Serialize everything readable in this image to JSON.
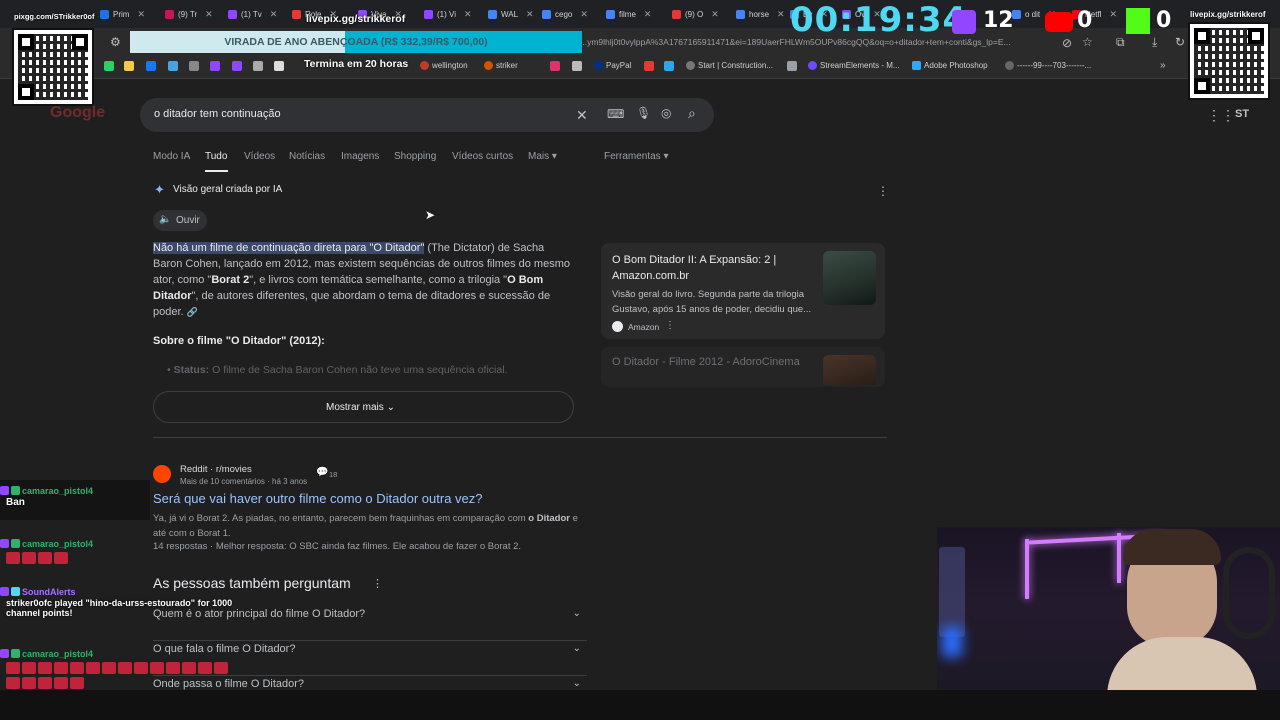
{
  "browser": {
    "tabs": [
      "Prim",
      "(9) Tr",
      "(1) Tv",
      "Role",
      "Viva",
      "(1) Vi",
      "WAL",
      "cego",
      "filme",
      "(9) O",
      "horse",
      "Ev",
      "Ov",
      "o dit",
      "Netfl"
    ],
    "url": "...ym9lhlj0t0vylppA%3A1767165911471&ei=189UaerFHLWm5OUPv86cgQQ&oq=o+ditador+tem+conti&gs_lp=E...",
    "bookmarks": [
      "wellington",
      "striker",
      "PayPal",
      "Start | Construction...",
      "StreamElements - M...",
      "Adobe Photoshop",
      "------99----703-------..."
    ]
  },
  "stream": {
    "qr_left_label": "pixgg.com/STrikker0of",
    "qr_right_label": "livepix.gg/strikkerof",
    "donation_title": "livepix.gg/strikkerof",
    "donation_text": "VIRADA DE ANO ABENÇOADA (R$ 332,39/R$ 700,00)",
    "donation_progress": 0.475,
    "donation_sub": "Termina em 20 horas",
    "timer": "00:19:34",
    "twitch_count": "12",
    "youtube_count": "0",
    "kick_count": "0"
  },
  "search": {
    "query": "o ditador tem continuação",
    "logo": "Google",
    "nav": [
      "Modo IA",
      "Tudo",
      "Vídeos",
      "Notícias",
      "Imagens",
      "Shopping",
      "Vídeos curtos",
      "Mais",
      "Ferramentas"
    ],
    "active_nav": "Tudo",
    "avatar_initials": "ST"
  },
  "ai_overview": {
    "title": "Visão geral criada por IA",
    "listen": "Ouvir",
    "highlight": "Não há um filme de continuação direta para \"O Ditador\"",
    "p1": " (The Dictator) de Sacha Baron Cohen, lançado em 2012, mas existem sequências de outros filmes do mesmo ator, como \"",
    "b1": "Borat 2",
    "p2": "\", e livros com temática semelhante, como a trilogia \"",
    "b2": "O Bom Ditador",
    "p3": "\", de autores diferentes, que abordam o tema de ditadores e sucessão de poder.",
    "section_title": "Sobre o filme \"O Ditador\" (2012):",
    "status_label": "Status:",
    "status_text": " O filme de Sacha Baron Cohen não teve uma sequência oficial.",
    "show_more": "Mostrar mais",
    "card1_title": "O Bom Ditador II: A Expansão: 2 | Amazon.com.br",
    "card1_desc": "Visão geral do livro. Segunda parte da trilogia Gustavo, após 15 anos de poder, decidiu que...",
    "card1_source": "Amazon",
    "card2_title": "O Ditador - Filme 2012 - AdoroCinema"
  },
  "reddit": {
    "site": "Reddit · r/movies",
    "meta": "Mais de 10 comentários · há 3 anos",
    "count": "18",
    "title": "Será que vai haver outro filme como o Ditador outra vez?",
    "snippet_a": "Ya, já vi o Borat 2. As piadas, no entanto, parecem bem fraquinhas em comparação com ",
    "snippet_b": "o Ditador",
    "snippet_c": " e até com o Borat 1.",
    "responses": "14 respostas · Melhor resposta: O SBC ainda faz filmes. Ele acabou de fazer o Borat 2."
  },
  "paa": {
    "title": "As pessoas também perguntam",
    "questions": [
      "Quem é o ator principal do filme O Ditador?",
      "O que fala o filme O Ditador?",
      "Onde passa o filme O Ditador?"
    ]
  },
  "chat": [
    {
      "user": "camarao_pistol4",
      "message": "Ban"
    },
    {
      "user": "camarao_pistol4",
      "message": ""
    },
    {
      "user": "SoundAlerts",
      "message": "striker0ofc played \"hino-da-urss-estourado\" for 1000 channel points!"
    },
    {
      "user": "camarao_pistol4",
      "message": ""
    }
  ],
  "colors": {
    "accent_cyan": "#4fd8f2",
    "link_blue": "#99c3ff",
    "chat_green": "#2fb36c",
    "sound_purple": "#a970ff"
  }
}
